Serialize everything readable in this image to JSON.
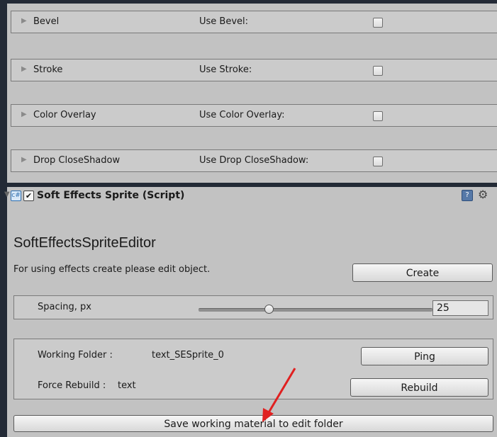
{
  "effects": [
    {
      "title": "Bevel",
      "use_label": "Use Bevel:"
    },
    {
      "title": "Stroke",
      "use_label": "Use Stroke:"
    },
    {
      "title": "Color Overlay",
      "use_label": "Use Color Overlay:"
    },
    {
      "title": "Drop CloseShadow",
      "use_label": "Use Drop CloseShadow:"
    }
  ],
  "component": {
    "title": "Soft Effects Sprite (Script)",
    "enabled_glyph": "✔",
    "script_glyph": "c#",
    "help_glyph": "?",
    "gear_glyph": "⚙"
  },
  "editor": {
    "title": "SoftEffectsSpriteEditor",
    "info": "For using effects create please edit object.",
    "create_label": "Create",
    "spacing_label": "Spacing, px",
    "spacing_value": "25",
    "spacing_slider_fraction": 0.3,
    "working_folder_label": "Working Folder :",
    "working_folder_value": "text_SESprite_0",
    "ping_label": "Ping",
    "force_rebuild_label": "Force Rebuild :",
    "force_rebuild_value": "text",
    "rebuild_label": "Rebuild",
    "save_label": "Save working material to edit folder"
  },
  "colors": {
    "background": "#232a36",
    "panel": "#c2c2c2",
    "annotation_arrow": "#e02020"
  }
}
